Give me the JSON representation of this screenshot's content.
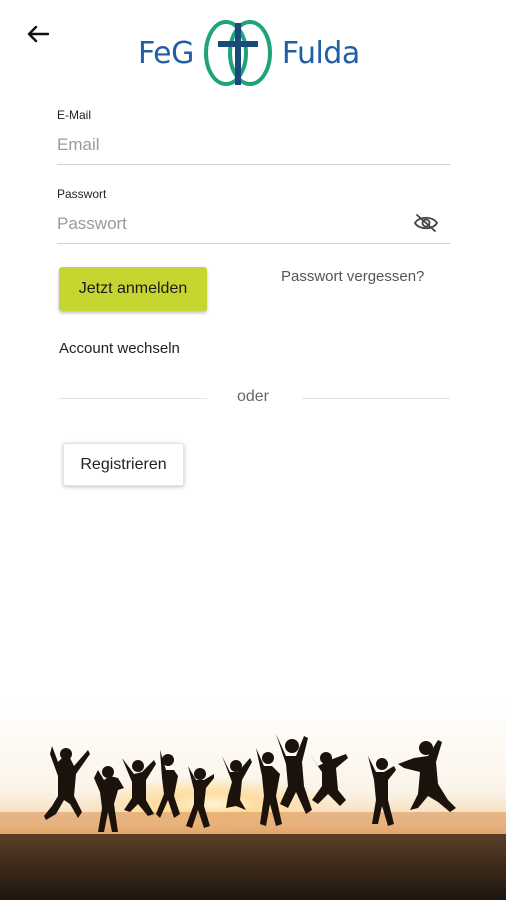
{
  "header": {
    "back_icon": "arrow-left-icon",
    "logo": {
      "text_left": "FeG",
      "text_right": "Fulda",
      "brand_blue": "#1f5fa6",
      "brand_green": "#1ea37a"
    }
  },
  "form": {
    "email": {
      "label": "E-Mail",
      "placeholder": "Email",
      "value": ""
    },
    "password": {
      "label": "Passwort",
      "placeholder": "Passwort",
      "value": "",
      "toggle_icon": "eye-off-icon"
    },
    "login_label": "Jetzt anmelden",
    "forgot_label": "Passwort vergessen?",
    "switch_account_label": "Account wechseln",
    "divider_label": "oder",
    "register_label": "Registrieren"
  },
  "colors": {
    "accent": "#c6d52f",
    "background": "#ffffff"
  },
  "footer_image": {
    "description_icon": "jumping-people-sunset-image"
  }
}
